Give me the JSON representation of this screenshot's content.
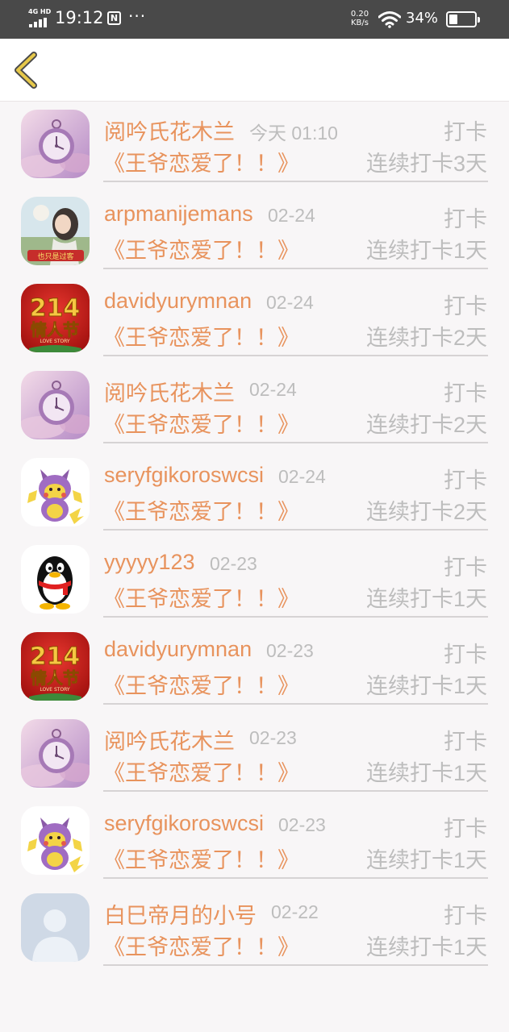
{
  "status_bar": {
    "network": "4G HD",
    "time": "19:12",
    "nfc_label": "N",
    "more": "···",
    "speed_value": "0.20",
    "speed_unit": "KB/s",
    "battery_pct": "34%",
    "battery_level": 0.34
  },
  "nav": {
    "back_icon": "chevron-left-icon",
    "accent_color": "#e6c84a"
  },
  "colors": {
    "accent": "#e8935d",
    "muted": "#bdbdbd",
    "background": "#f8f6f7"
  },
  "records": [
    {
      "username": "阅吟氏花木兰",
      "time": "今天 01:10",
      "action": "打卡",
      "book": "《王爷恋爱了！！》",
      "streak": "连续打卡3天",
      "avatar": "pocket-watch"
    },
    {
      "username": "arpmanijemans",
      "time": "02-24",
      "action": "打卡",
      "book": "《王爷恋爱了！！》",
      "streak": "连续打卡1天",
      "avatar": "girl-photo"
    },
    {
      "username": "davidyurymnan",
      "time": "02-24",
      "action": "打卡",
      "book": "《王爷恋爱了！！》",
      "streak": "连续打卡2天",
      "avatar": "valentine-214"
    },
    {
      "username": "阅吟氏花木兰",
      "time": "02-24",
      "action": "打卡",
      "book": "《王爷恋爱了！！》",
      "streak": "连续打卡2天",
      "avatar": "pocket-watch"
    },
    {
      "username": "seryfgikoroswcsi",
      "time": "02-24",
      "action": "打卡",
      "book": "《王爷恋爱了！！》",
      "streak": "连续打卡2天",
      "avatar": "purple-pikachu"
    },
    {
      "username": "yyyyy123",
      "time": "02-23",
      "action": "打卡",
      "book": "《王爷恋爱了！！》",
      "streak": "连续打卡1天",
      "avatar": "qq-penguin"
    },
    {
      "username": "davidyurymnan",
      "time": "02-23",
      "action": "打卡",
      "book": "《王爷恋爱了！！》",
      "streak": "连续打卡1天",
      "avatar": "valentine-214"
    },
    {
      "username": "阅吟氏花木兰",
      "time": "02-23",
      "action": "打卡",
      "book": "《王爷恋爱了！！》",
      "streak": "连续打卡1天",
      "avatar": "pocket-watch"
    },
    {
      "username": "seryfgikoroswcsi",
      "time": "02-23",
      "action": "打卡",
      "book": "《王爷恋爱了！！》",
      "streak": "连续打卡1天",
      "avatar": "purple-pikachu"
    },
    {
      "username": "白巳帝月的小号",
      "time": "02-22",
      "action": "打卡",
      "book": "《王爷恋爱了！！》",
      "streak": "连续打卡1天",
      "avatar": "default-user"
    }
  ],
  "avatar_texts": {
    "girl_caption": "也只是过客",
    "valentine_number": "214",
    "valentine_title": "情人节",
    "valentine_sub": "LOVE STORY"
  }
}
